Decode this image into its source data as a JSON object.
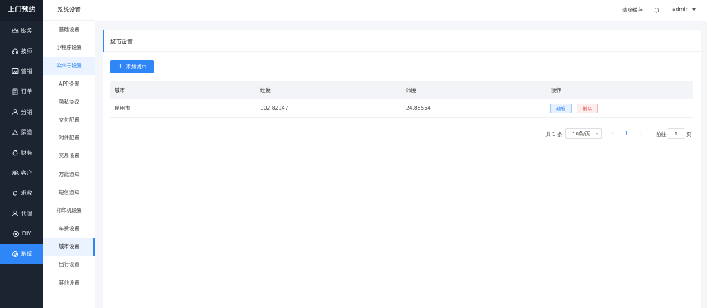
{
  "brand": "上门预约",
  "nav": [
    {
      "label": "服务",
      "icon": "crown-icon"
    },
    {
      "label": "技师",
      "icon": "headset-icon"
    },
    {
      "label": "营销",
      "icon": "image-icon"
    },
    {
      "label": "订单",
      "icon": "document-icon"
    },
    {
      "label": "分销",
      "icon": "users-icon"
    },
    {
      "label": "渠道",
      "icon": "recycle-icon"
    },
    {
      "label": "财务",
      "icon": "money-bag-icon"
    },
    {
      "label": "客户",
      "icon": "group-icon"
    },
    {
      "label": "求救",
      "icon": "bell-icon"
    },
    {
      "label": "代理",
      "icon": "user-icon"
    },
    {
      "label": "DIY",
      "icon": "palette-icon"
    },
    {
      "label": "系统",
      "icon": "gear-icon"
    }
  ],
  "subnav": {
    "title": "系统设置",
    "items": [
      "基础设置",
      "小程序设置",
      "公众号设置",
      "APP设置",
      "隐私协议",
      "支付配置",
      "附件配置",
      "交易设置",
      "万能通知",
      "短信通知",
      "打印机设置",
      "车费设置",
      "城市设置",
      "出行设置",
      "其他设置"
    ]
  },
  "header": {
    "clear_cache": "清除缓存",
    "user": "admin"
  },
  "panel": {
    "title": "城市设置",
    "add_button": "添加城市"
  },
  "table": {
    "columns": [
      "城市",
      "经度",
      "纬度",
      "操作"
    ],
    "rows": [
      {
        "city": "昆明市",
        "lng": "102.82147",
        "lat": "24.88554",
        "edit": "编辑",
        "delete": "删除"
      }
    ]
  },
  "pagination": {
    "total": "共 1 条",
    "page_size": "10条/页",
    "current_page": "1",
    "goto_label": "前往",
    "goto_value": "1",
    "page_suffix": "页"
  },
  "colors": {
    "accent": "#2f86f6",
    "sidebar": "#1c2431",
    "danger": "#e04848"
  }
}
